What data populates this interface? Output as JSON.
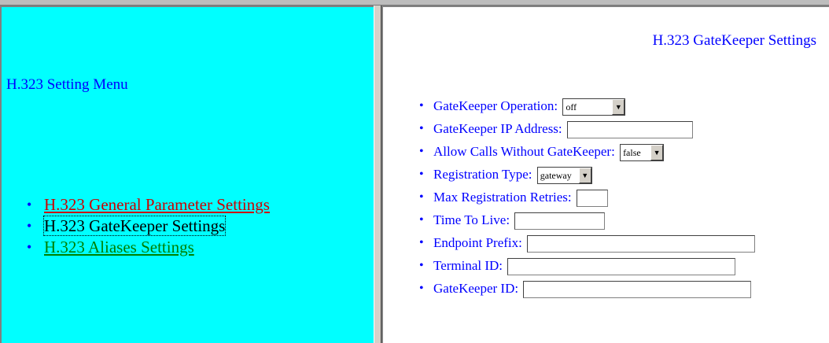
{
  "menu": {
    "title": "H.323 Setting Menu",
    "links": {
      "general": "H.323 General Parameter Settings",
      "gatekeeper": "H.323 GateKeeper Settings",
      "aliases": "H.323 Aliases Settings"
    },
    "colors": {
      "background": "#00ffff",
      "general": "#cc0000",
      "gatekeeper": "#000000",
      "aliases": "#008000"
    }
  },
  "form": {
    "title": "H.323 GateKeeper Settings",
    "fields": {
      "operation": {
        "label": "GateKeeper Operation:",
        "value": "off"
      },
      "ip": {
        "label": "GateKeeper IP Address:",
        "value": ""
      },
      "allow_calls": {
        "label": "Allow Calls Without GateKeeper:",
        "value": "false"
      },
      "registration_type": {
        "label": "Registration Type:",
        "value": "gateway"
      },
      "max_retries": {
        "label": "Max Registration Retries:",
        "value": ""
      },
      "ttl": {
        "label": "Time To Live:",
        "value": ""
      },
      "endpoint_prefix": {
        "label": "Endpoint Prefix:",
        "value": ""
      },
      "terminal_id": {
        "label": "Terminal ID:",
        "value": ""
      },
      "gatekeeper_id": {
        "label": "GateKeeper ID:",
        "value": ""
      }
    },
    "colors": {
      "text": "#0000ff"
    }
  }
}
